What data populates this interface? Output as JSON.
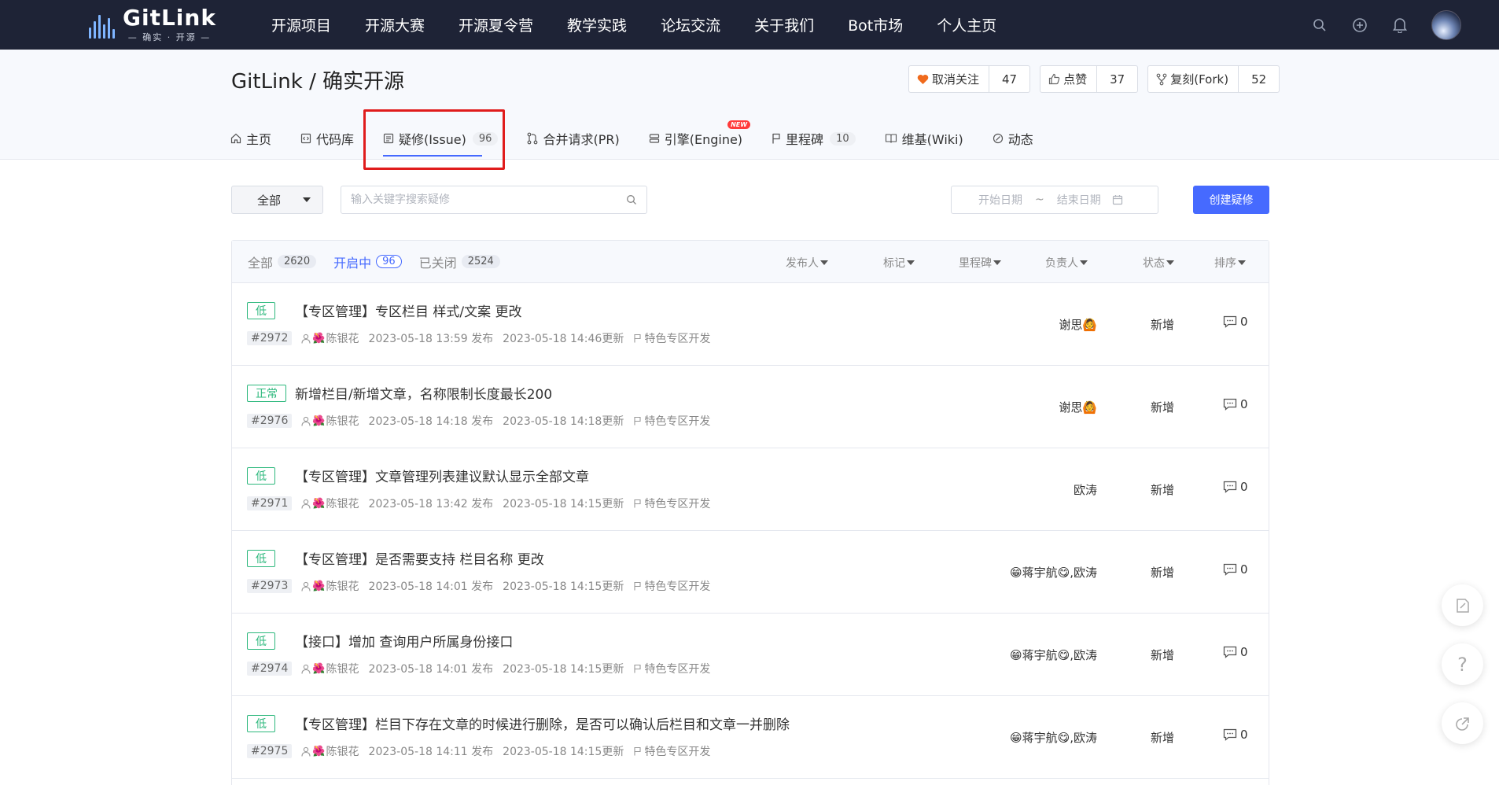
{
  "nav": {
    "logo_title": "GitLink",
    "logo_sub": "— 确实 · 开源 —",
    "items": [
      "开源项目",
      "开源大赛",
      "开源夏令营",
      "教学实践",
      "论坛交流",
      "关于我们",
      "Bot市场",
      "个人主页"
    ]
  },
  "repo": {
    "title": "GitLink / 确实开源",
    "actions": [
      {
        "label": "取消关注",
        "count": "47",
        "icon": "heart-icon"
      },
      {
        "label": "点赞",
        "count": "37",
        "icon": "thumbs-up-icon"
      },
      {
        "label": "复刻(Fork)",
        "count": "52",
        "icon": "fork-icon"
      }
    ]
  },
  "tabs": [
    {
      "label": "主页",
      "icon": "home-icon"
    },
    {
      "label": "代码库",
      "icon": "code-icon"
    },
    {
      "label": "疑修(Issue)",
      "badge": "96",
      "icon": "issue-icon",
      "active": true
    },
    {
      "label": "合并请求(PR)",
      "icon": "pull-request-icon"
    },
    {
      "label": "引擎(Engine)",
      "icon": "engine-icon",
      "tag": "NEW"
    },
    {
      "label": "里程碑",
      "badge": "10",
      "icon": "milestone-icon"
    },
    {
      "label": "维基(Wiki)",
      "icon": "wiki-icon"
    },
    {
      "label": "动态",
      "icon": "activity-icon"
    }
  ],
  "filters": {
    "select_value": "全部",
    "search_placeholder": "输入关键字搜索疑修",
    "date_start": "开始日期",
    "date_sep": "~",
    "date_end": "结束日期",
    "create_label": "创建疑修"
  },
  "list_head": {
    "status_tabs": [
      {
        "label": "全部",
        "count": "2620"
      },
      {
        "label": "开启中",
        "count": "96",
        "active": true
      },
      {
        "label": "已关闭",
        "count": "2524"
      }
    ],
    "columns": [
      "发布人",
      "标记",
      "里程碑",
      "负责人",
      "状态",
      "排序"
    ]
  },
  "issues": [
    {
      "priority": "低",
      "title": "【专区管理】专区栏目 样式/文案 更改",
      "id": "#2972",
      "author": "陈银花",
      "created": "2023-05-18 13:59 发布",
      "updated": "2023-05-18 14:46更新",
      "milestone": "特色专区开发",
      "assignee": "谢思🙆",
      "state": "新增",
      "comments": "0"
    },
    {
      "priority": "正常",
      "title": "新增栏目/新增文章，名称限制长度最长200",
      "id": "#2976",
      "author": "陈银花",
      "created": "2023-05-18 14:18 发布",
      "updated": "2023-05-18 14:18更新",
      "milestone": "特色专区开发",
      "assignee": "谢思🙆",
      "state": "新增",
      "comments": "0"
    },
    {
      "priority": "低",
      "title": "【专区管理】文章管理列表建议默认显示全部文章",
      "id": "#2971",
      "author": "陈银花",
      "created": "2023-05-18 13:42 发布",
      "updated": "2023-05-18 14:15更新",
      "milestone": "特色专区开发",
      "assignee": "欧涛",
      "state": "新增",
      "comments": "0"
    },
    {
      "priority": "低",
      "title": "【专区管理】是否需要支持 栏目名称 更改",
      "id": "#2973",
      "author": "陈银花",
      "created": "2023-05-18 14:01 发布",
      "updated": "2023-05-18 14:15更新",
      "milestone": "特色专区开发",
      "assignee": "😁蒋宇航😋,欧涛",
      "state": "新增",
      "comments": "0"
    },
    {
      "priority": "低",
      "title": "【接口】增加 查询用户所属身份接口",
      "id": "#2974",
      "author": "陈银花",
      "created": "2023-05-18 14:01 发布",
      "updated": "2023-05-18 14:15更新",
      "milestone": "特色专区开发",
      "assignee": "😁蒋宇航😋,欧涛",
      "state": "新增",
      "comments": "0"
    },
    {
      "priority": "低",
      "title": "【专区管理】栏目下存在文章的时候进行删除，是否可以确认后栏目和文章一并删除",
      "id": "#2975",
      "author": "陈银花",
      "created": "2023-05-18 14:11 发布",
      "updated": "2023-05-18 14:15更新",
      "milestone": "特色专区开发",
      "assignee": "😁蒋宇航😋,欧涛",
      "state": "新增",
      "comments": "0"
    }
  ],
  "author_emoji": "🌺",
  "side": {
    "help": "?"
  },
  "colors": {
    "accent": "#466aff",
    "nav_bg": "#1e2336",
    "priority_green": "#2db87d",
    "highlight_red": "#e01c1c"
  }
}
